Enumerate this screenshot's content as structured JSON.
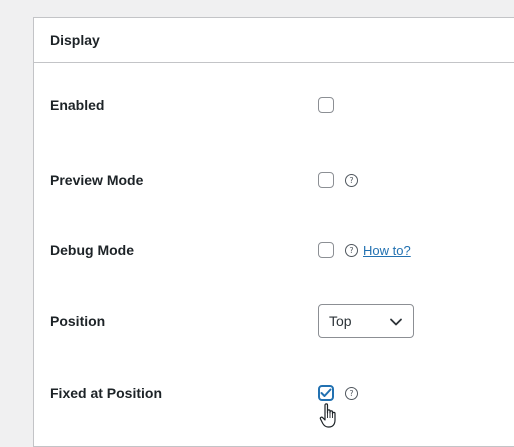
{
  "panel": {
    "title": "Display"
  },
  "rows": [
    {
      "label": "Enabled",
      "checked": false,
      "help": false
    },
    {
      "label": "Preview Mode",
      "checked": false,
      "help": true
    },
    {
      "label": "Debug Mode",
      "checked": false,
      "help": true,
      "link": "How to?"
    },
    {
      "label": "Position",
      "select_value": "Top"
    },
    {
      "label": "Fixed at Position",
      "checked": true,
      "help": true
    }
  ],
  "icons": {
    "help": "?",
    "select_chevron": "chevron-down-icon",
    "cursor": "hand-pointer-icon"
  },
  "colors": {
    "link": "#2271b1",
    "checkbox_checked": "#2271b1",
    "border": "#c3c4c7"
  }
}
